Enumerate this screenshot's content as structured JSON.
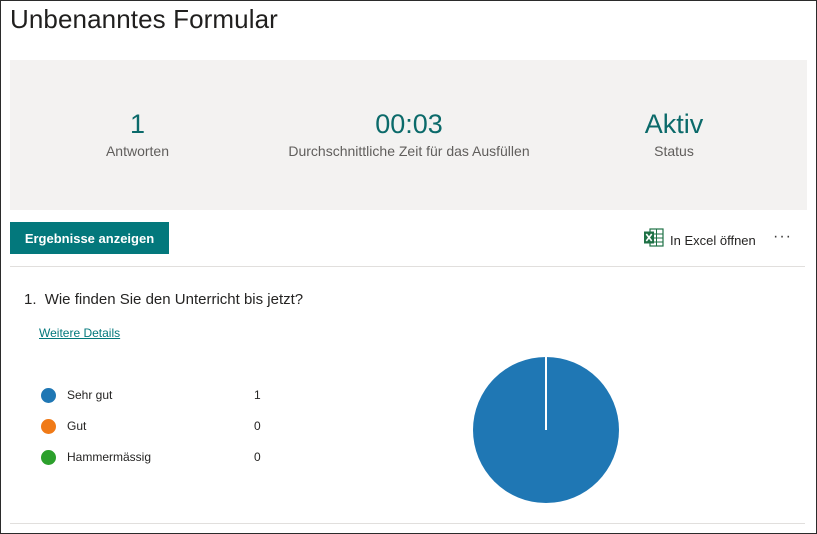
{
  "form": {
    "title": "Unbenanntes Formular"
  },
  "summary": {
    "responses": {
      "value": "1",
      "label": "Antworten"
    },
    "avg_time": {
      "value": "00:03",
      "label": "Durchschnittliche Zeit für das Ausfüllen"
    },
    "status": {
      "value": "Aktiv",
      "label": "Status"
    }
  },
  "toolbar": {
    "results_button": "Ergebnisse anzeigen",
    "excel_label": "In Excel öffnen",
    "excel_icon": "excel-icon",
    "more_label": "···"
  },
  "question": {
    "number": "1.",
    "text": "Wie finden Sie den Unterricht bis jetzt?",
    "details_link": "Weitere Details",
    "options": [
      {
        "label": "Sehr gut",
        "count": "1",
        "color": "#1f77b4"
      },
      {
        "label": "Gut",
        "count": "0",
        "color": "#f07a17"
      },
      {
        "label": "Hammermässig",
        "count": "0",
        "color": "#2ca02c"
      }
    ]
  },
  "chart_data": {
    "type": "pie",
    "categories": [
      "Sehr gut",
      "Gut",
      "Hammermässig"
    ],
    "values": [
      1,
      0,
      0
    ],
    "colors": [
      "#1f77b4",
      "#f07a17",
      "#2ca02c"
    ]
  },
  "colors": {
    "accent": "#03787c",
    "stat_value": "#0b6a6a",
    "summary_bg": "#f3f2f1"
  }
}
